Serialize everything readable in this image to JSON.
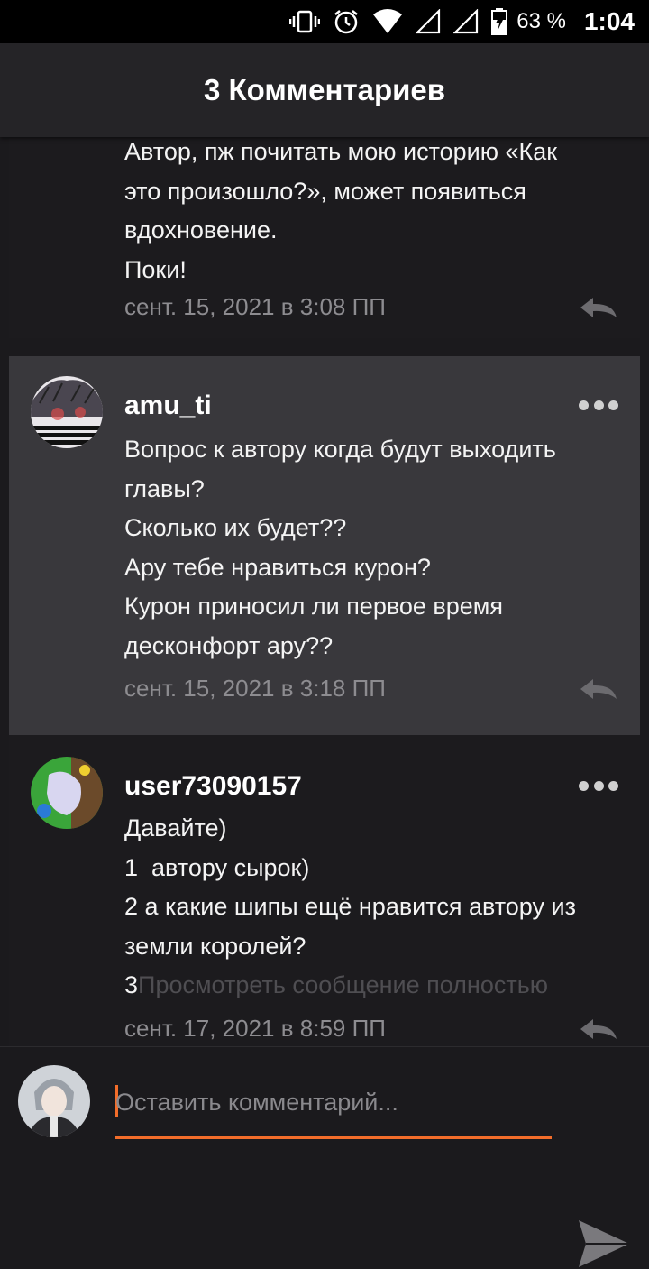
{
  "status_bar": {
    "battery_percent": "63 %",
    "time": "1:04",
    "icons": [
      "vibrate-icon",
      "alarm-icon",
      "wifi-icon",
      "signal-icon",
      "signal-icon",
      "battery-charging-icon"
    ]
  },
  "header": {
    "title": "3 Комментариев"
  },
  "comments": [
    {
      "text": [
        "Автор, пж почитать мою историю «Как",
        "это произошло?», может появиться",
        "вдохновение.",
        "Поки!"
      ],
      "date": "сент. 15, 2021 в 3:08 ПП"
    },
    {
      "username": "amu_ti",
      "text": [
        "Вопрос к автору когда будут выходить",
        "главы?",
        "Сколько их будет??",
        "Ару тебе нравиться курон?",
        "Курон приносил ли первое время",
        "десконфорт ару??"
      ],
      "date": "сент. 15, 2021 в 3:18 ПП"
    },
    {
      "username": "user73090157",
      "text": [
        "Давайте)",
        "1  автору сырок)",
        "2 а какие шипы ещё нравится автору из",
        "земли королей?"
      ],
      "last_line_prefix": "3",
      "view_full_label": "Просмотреть сообщение полностью",
      "date": "сент. 17, 2021 в 8:59 ПП"
    }
  ],
  "composer": {
    "placeholder": "Оставить комментарий..."
  },
  "colors": {
    "accent": "#f36d2a",
    "highlight_bg": "#39383c",
    "background": "#1b1a1d"
  }
}
